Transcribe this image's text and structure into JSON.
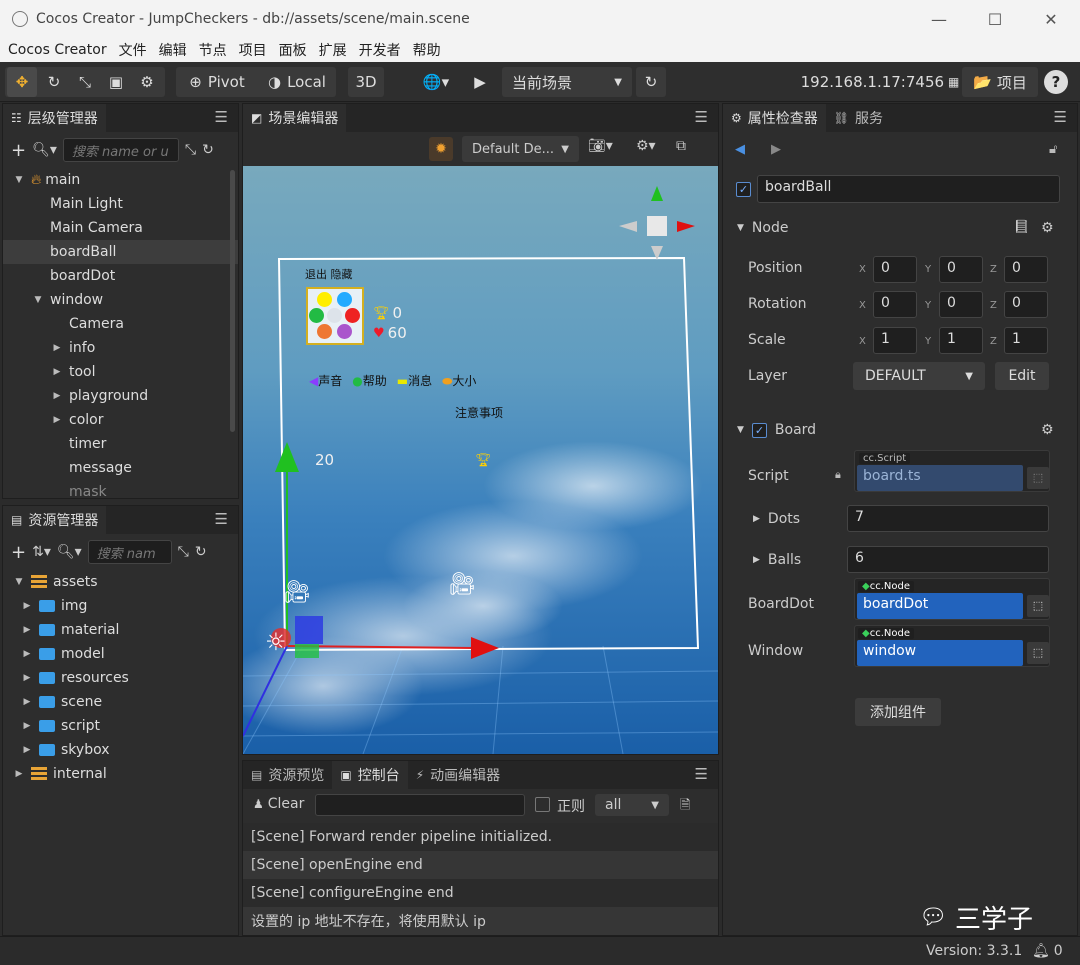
{
  "window": {
    "title": "Cocos Creator - JumpCheckers - db://assets/scene/main.scene",
    "min": "—",
    "max": "☐",
    "close": "✕"
  },
  "menu": [
    "Cocos Creator",
    "文件",
    "编辑",
    "节点",
    "项目",
    "面板",
    "扩展",
    "开发者",
    "帮助"
  ],
  "toolbar": {
    "pivot": "Pivot",
    "local": "Local",
    "three_d": "3D",
    "scene_select": "当前场景",
    "ip": "192.168.1.17:7456",
    "project": "项目",
    "help": "?"
  },
  "hierarchy": {
    "title": "层级管理器",
    "search_placeholder": "搜索 name or u",
    "items": [
      {
        "label": "main",
        "arrow": "▼"
      },
      {
        "label": "Main Light",
        "arrow": ""
      },
      {
        "label": "Main Camera",
        "arrow": ""
      },
      {
        "label": "boardBall",
        "arrow": ""
      },
      {
        "label": "boardDot",
        "arrow": ""
      },
      {
        "label": "window",
        "arrow": "▼"
      },
      {
        "label": "Camera",
        "arrow": ""
      },
      {
        "label": "info",
        "arrow": "▶"
      },
      {
        "label": "tool",
        "arrow": "▶"
      },
      {
        "label": "playground",
        "arrow": "▶"
      },
      {
        "label": "color",
        "arrow": "▶"
      },
      {
        "label": "timer",
        "arrow": ""
      },
      {
        "label": "message",
        "arrow": ""
      },
      {
        "label": "mask",
        "arrow": ""
      }
    ]
  },
  "assets": {
    "title": "资源管理器",
    "search_placeholder": "搜索 nam",
    "items": [
      {
        "label": "assets",
        "arrow": "▼"
      },
      {
        "label": "img",
        "arrow": "▶"
      },
      {
        "label": "material",
        "arrow": "▶"
      },
      {
        "label": "model",
        "arrow": "▶"
      },
      {
        "label": "resources",
        "arrow": "▶"
      },
      {
        "label": "scene",
        "arrow": "▶"
      },
      {
        "label": "script",
        "arrow": "▶"
      },
      {
        "label": "skybox",
        "arrow": "▶"
      },
      {
        "label": "internal",
        "arrow": "▶"
      }
    ]
  },
  "scene_editor": {
    "title": "场景编辑器",
    "layout_select": "Default De...",
    "game": {
      "tabs_text": "退出  隐藏",
      "trophy_count": "0",
      "heart_count": "60",
      "menu_items": [
        "声音",
        "帮助",
        "消息",
        "大小"
      ],
      "notice": "注意事项",
      "axis_value": "20",
      "dot_colors": [
        "#ffee00",
        "#22aaff",
        "#22bb44",
        "#dde3ea",
        "#ee2222",
        "#ee7733",
        "#aa55cc"
      ]
    }
  },
  "bottom_panel": {
    "tabs": [
      "资源预览",
      "控制台",
      "动画编辑器"
    ],
    "clear": "Clear",
    "regex": "正则",
    "filter": "all",
    "logs": [
      "[Scene] Forward render pipeline initialized.",
      "[Scene] openEngine end",
      "[Scene] configureEngine end",
      "设置的 ip 地址不存在，将使用默认 ip"
    ]
  },
  "inspector": {
    "tabs": [
      "属性检查器",
      "服务"
    ],
    "node_name": "boardBall",
    "node_section": "Node",
    "position": {
      "label": "Position",
      "x": "0",
      "y": "0",
      "z": "0"
    },
    "rotation": {
      "label": "Rotation",
      "x": "0",
      "y": "0",
      "z": "0"
    },
    "scale": {
      "label": "Scale",
      "x": "1",
      "y": "1",
      "z": "1"
    },
    "layer": {
      "label": "Layer",
      "value": "DEFAULT",
      "edit": "Edit"
    },
    "component": "Board",
    "script": {
      "label": "Script",
      "tag": "cc.Script",
      "value": "board.ts"
    },
    "dots": {
      "label": "Dots",
      "value": "7"
    },
    "balls": {
      "label": "Balls",
      "value": "6"
    },
    "board_dot": {
      "label": "BoardDot",
      "tag": "cc.Node",
      "value": "boardDot"
    },
    "window_ref": {
      "label": "Window",
      "tag": "cc.Node",
      "value": "window"
    },
    "add_component": "添加组件"
  },
  "watermark": "三学子",
  "status": {
    "version": "Version: 3.3.1",
    "bell_count": "0"
  }
}
